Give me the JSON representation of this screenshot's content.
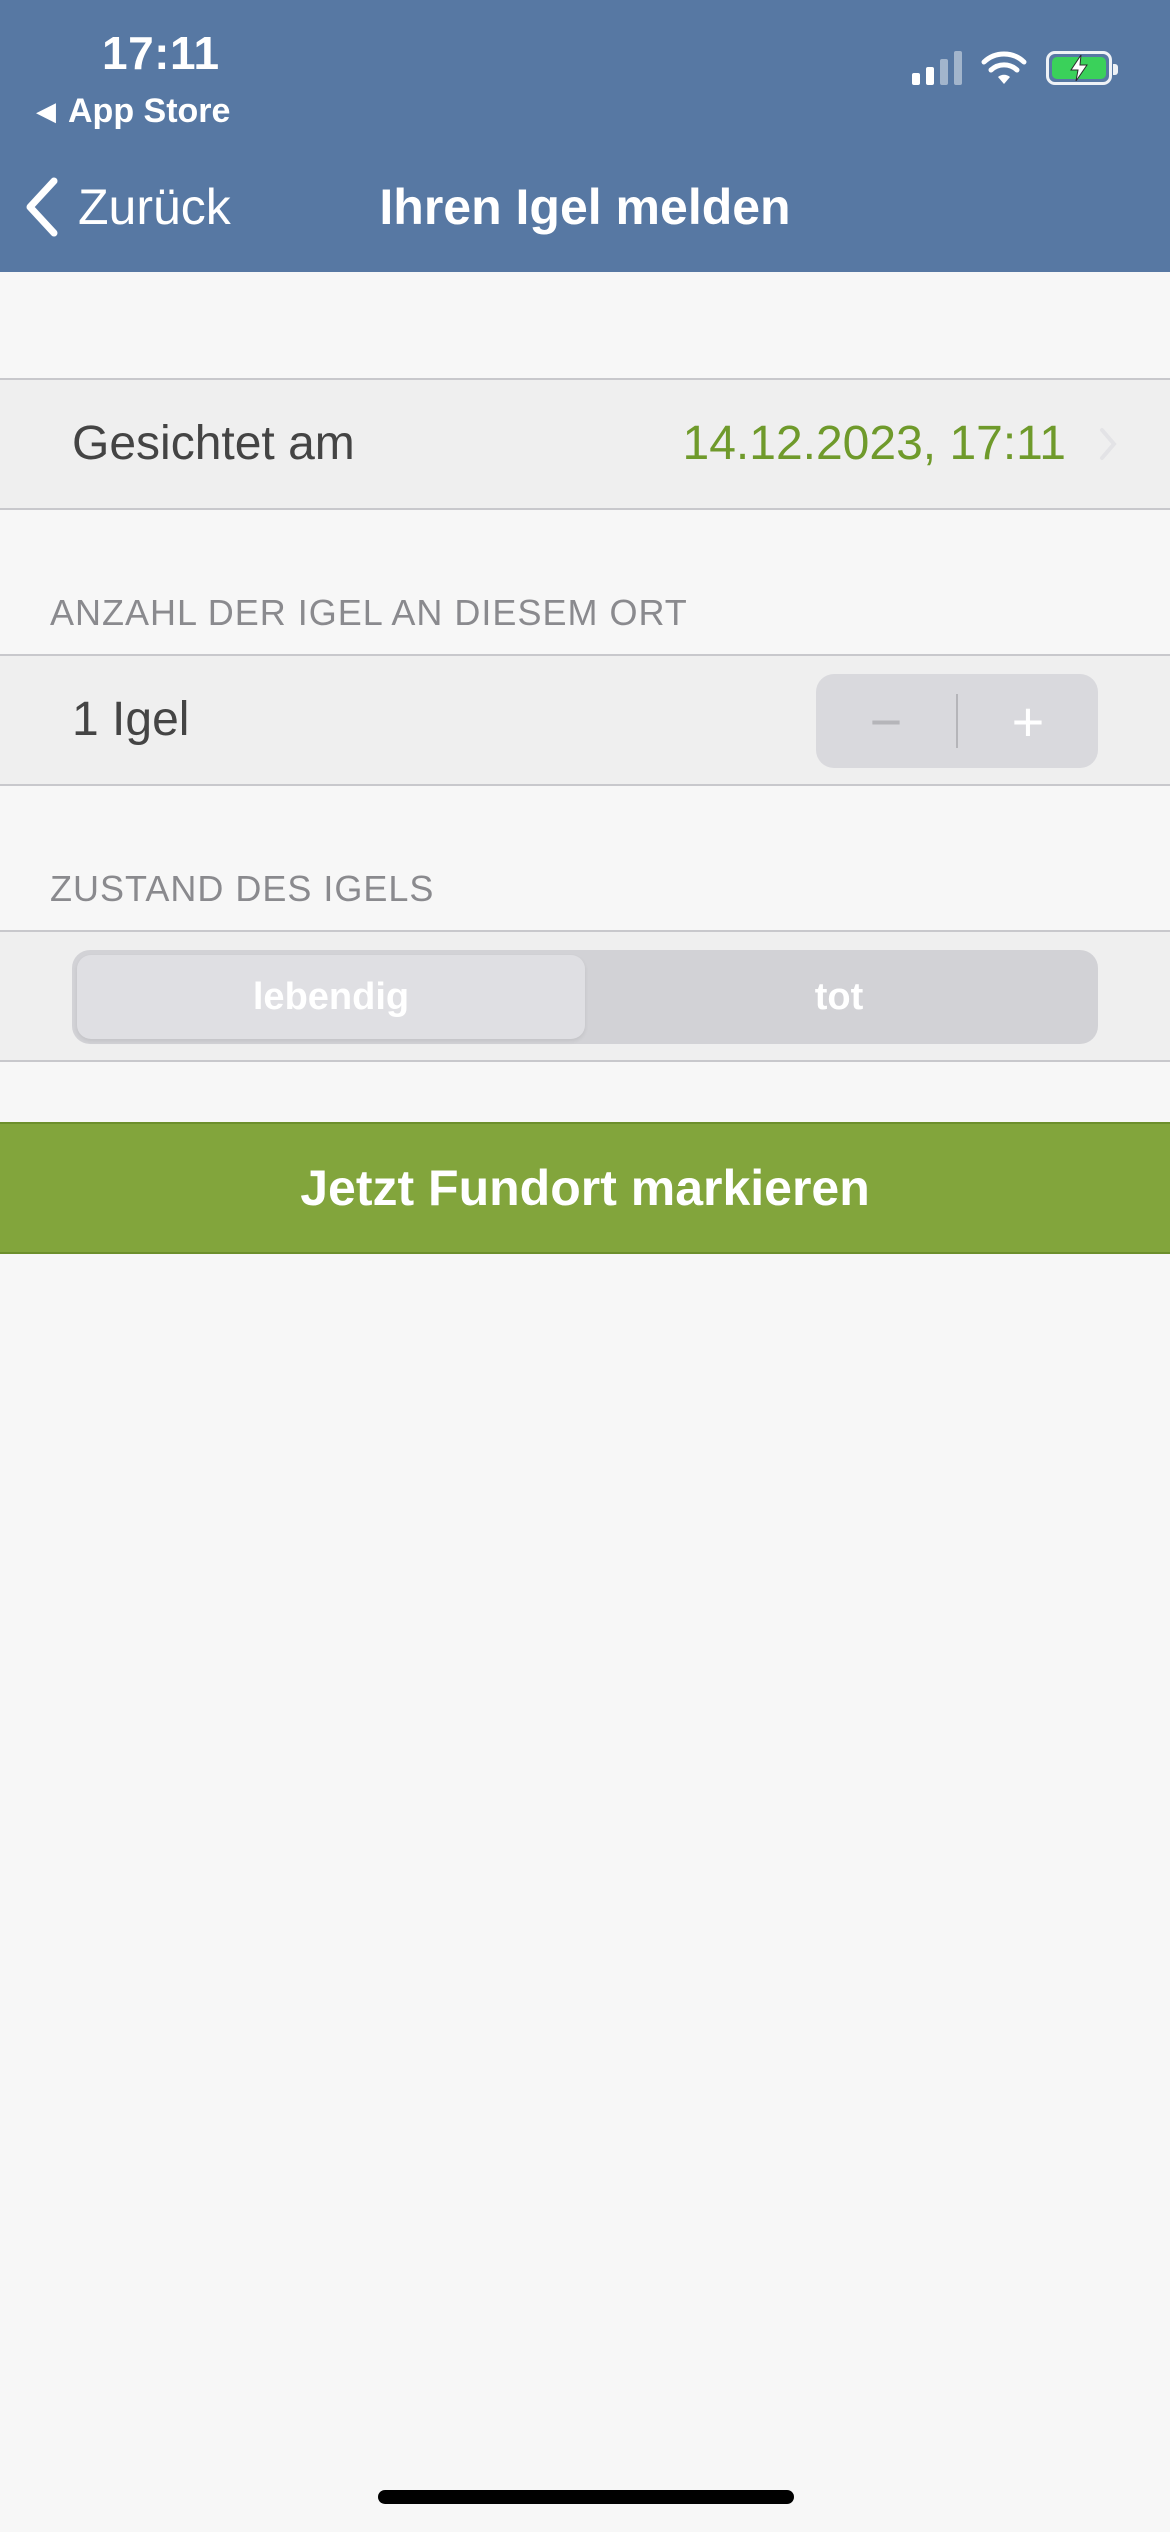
{
  "status_bar": {
    "time": "17:11",
    "back_app": "App Store"
  },
  "nav": {
    "back_label": "Zurück",
    "title": "Ihren Igel melden"
  },
  "sighting": {
    "label": "Gesichtet am",
    "value": "14.12.2023, 17:11"
  },
  "count_section": {
    "header": "ANZAHL DER IGEL AN DIESEM ORT",
    "value_label": "1 Igel",
    "stepper_minus": "−",
    "stepper_plus": "+"
  },
  "state_section": {
    "header": "ZUSTAND DES IGELS",
    "options": [
      "lebendig",
      "tot"
    ],
    "selected": "lebendig"
  },
  "primary_action": {
    "label": "Jetzt Fundort markieren"
  },
  "colors": {
    "nav_bar": "#5778a3",
    "accent_green": "#6f9a2b",
    "button_green": "#82a53c",
    "battery_green": "#3ad15a"
  },
  "icons": {
    "back": "chevron-left-icon",
    "disclosure": "chevron-right-icon",
    "signal": "cellular-signal-icon",
    "wifi": "wifi-icon",
    "battery": "battery-charging-icon"
  }
}
